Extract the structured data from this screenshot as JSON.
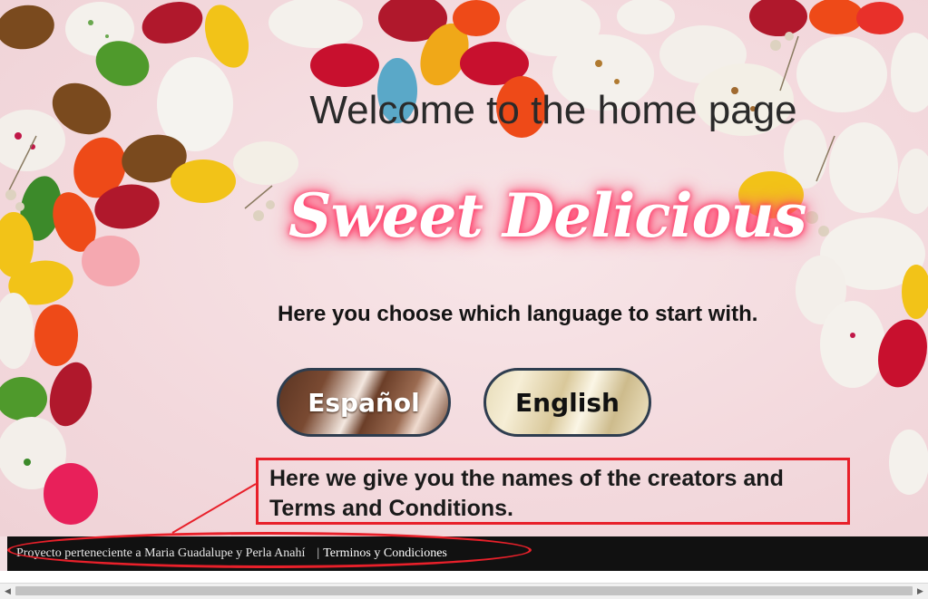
{
  "hero": {
    "welcome_title": "Welcome to the home page",
    "brand_logo_text": "Sweet Delicious"
  },
  "language": {
    "prompt": "Here you choose which language to start with.",
    "spanish_label": "Español",
    "english_label": "English"
  },
  "annotation": {
    "creators_note": "Here we give you the names of the creators and Terms and Conditions."
  },
  "footer": {
    "credits": "Proyecto perteneciente a Maria Guadalupe y Perla Anahí",
    "separator": "|",
    "terms_link": "Terminos y Condiciones"
  },
  "colors": {
    "annotation_red": "#e8202a",
    "footer_bg": "#111111",
    "logo_glow": "#ff2e5e"
  },
  "icons": {
    "scroll_left": "scroll-left-arrow-icon",
    "scroll_right": "scroll-right-arrow-icon"
  }
}
